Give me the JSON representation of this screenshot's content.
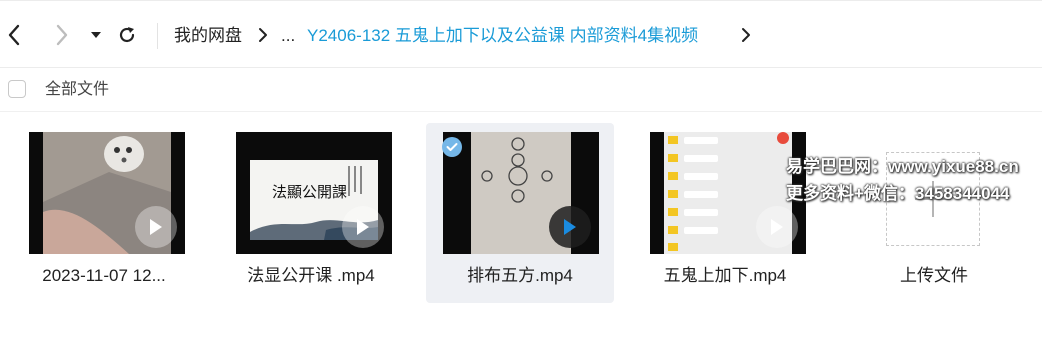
{
  "breadcrumb": {
    "root": "我的网盘",
    "ellipsis": "...",
    "current": "Y2406-132 五鬼上加下以及公益课 内部资料4集视频"
  },
  "toolbar": {
    "back_icon": "chevron-left-icon",
    "forward_icon": "chevron-right-icon",
    "dropdown_icon": "caret-down-icon",
    "refresh_icon": "refresh-icon"
  },
  "select_all": {
    "label": "全部文件",
    "checked": false
  },
  "files": [
    {
      "name": "2023-11-07 12...",
      "type": "video",
      "selected": false
    },
    {
      "name": "法显公开课 .mp4",
      "type": "video",
      "selected": false,
      "thumb_title": "法顯公開課"
    },
    {
      "name": "排布五方.mp4",
      "type": "video",
      "selected": true
    },
    {
      "name": "五鬼上加下.mp4",
      "type": "video",
      "selected": false
    }
  ],
  "upload": {
    "label": "上传文件"
  },
  "watermark": {
    "line1": "易学巴巴网：www.yixue88.cn",
    "line2": "更多资料+微信：3458344044"
  },
  "colors": {
    "accent": "#1a9bd7",
    "selected_bg": "#eef0f4",
    "check_badge": "#75b7e8"
  }
}
